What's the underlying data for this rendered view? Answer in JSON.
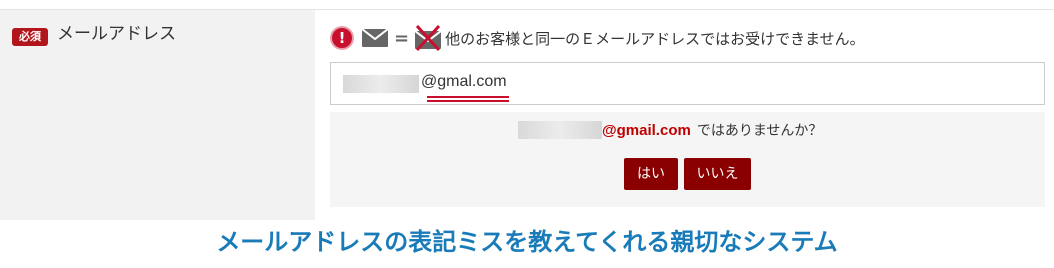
{
  "form": {
    "required_badge": "必須",
    "field_label": "メールアドレス",
    "notice": {
      "text": "他のお客様と同一のＥメールアドレスではお受けできません。",
      "warning_icon": "exclamation-circle-icon",
      "warning_glyph": "!",
      "mail_icon": "envelope-icon",
      "equals": "=",
      "crossed_mail_icon": "envelope-crossed-icon"
    },
    "email_input": {
      "value": "@gmal.com"
    },
    "suggestion": {
      "domain": "@gmail.com",
      "question": "ではありませんか？",
      "yes_label": "はい",
      "no_label": "いいえ"
    }
  },
  "caption": "メールアドレスの表記ミスを教えてくれる親切なシステム",
  "colors": {
    "badge": "#b3151d",
    "warning": "#c8102e",
    "suggest_domain": "#c00000",
    "button": "#8a0000",
    "caption": "#1a7bb9",
    "label_bg": "#f2f2f2"
  }
}
